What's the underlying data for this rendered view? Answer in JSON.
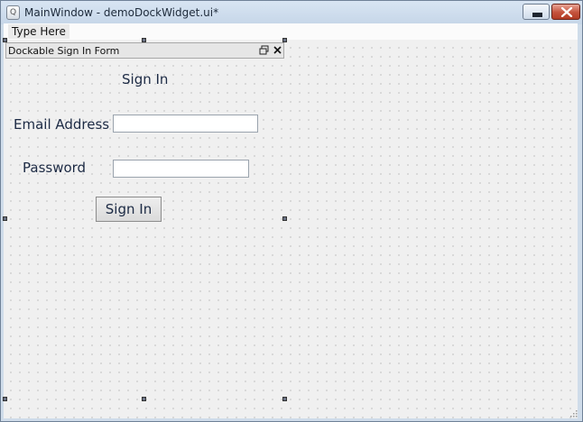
{
  "window": {
    "title": "MainWindow - demoDockWidget.ui*",
    "app_icon": "qt-designer-icon",
    "controls": [
      "minimize-icon",
      "close-icon"
    ]
  },
  "menubar": {
    "placeholder_item": "Type Here"
  },
  "dock": {
    "title": "Dockable Sign In Form",
    "title_buttons": [
      "float-icon",
      "close-icon"
    ]
  },
  "form": {
    "heading": "Sign In",
    "email_label": "Email Address",
    "email_value": "",
    "password_label": "Password",
    "password_value": "",
    "submit_label": "Sign In"
  },
  "colors": {
    "frame": "#cfdcea",
    "canvas": "#f0f0f0",
    "label_text": "#1c2a44",
    "close_button": "#c4523c"
  }
}
